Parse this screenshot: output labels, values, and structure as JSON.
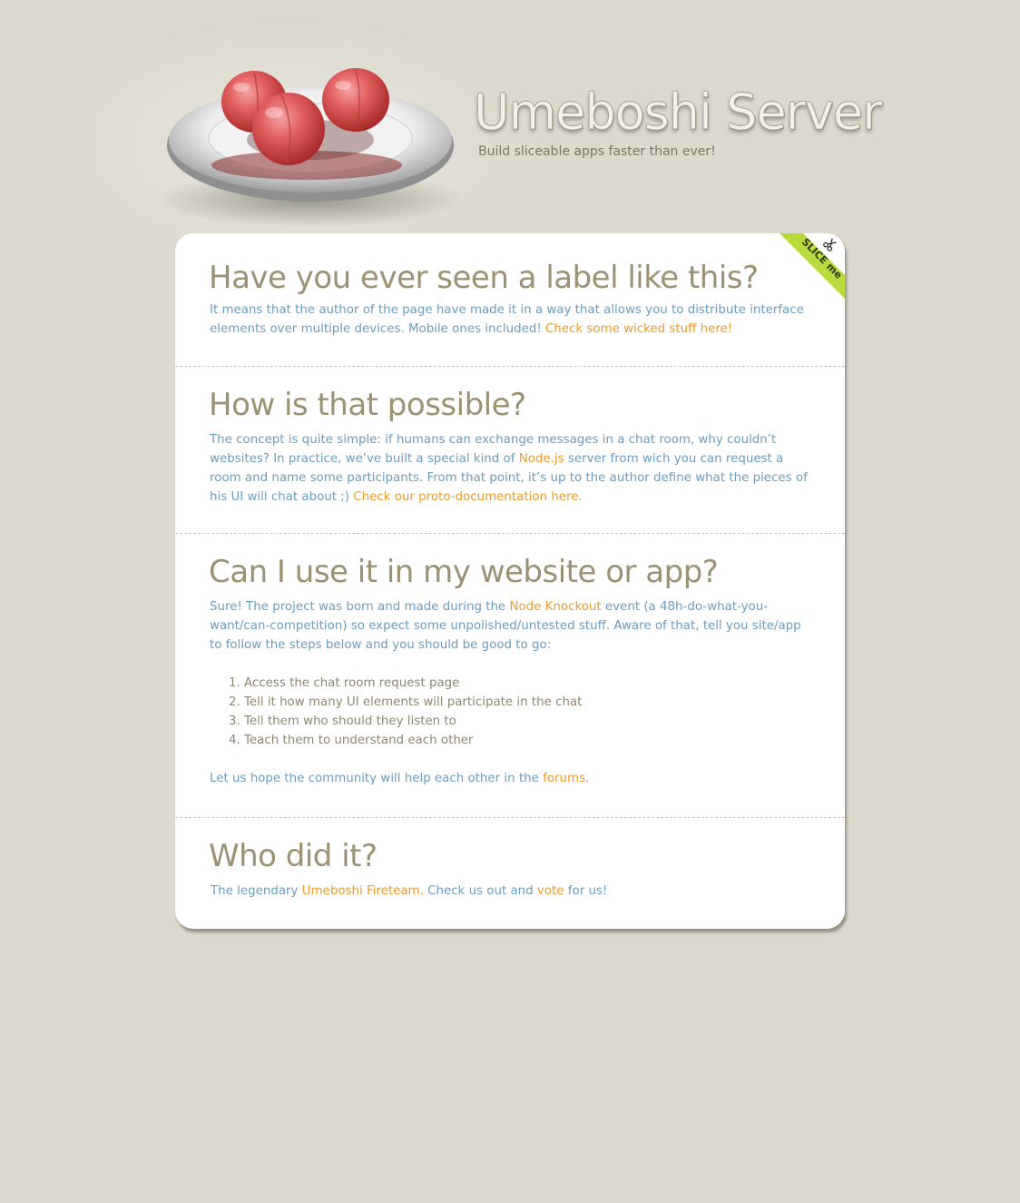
{
  "header": {
    "title": "Umeboshi Server",
    "tagline": "Build sliceable apps faster than ever!"
  },
  "badge": {
    "label": "SLICE me",
    "icon": "scissors-icon",
    "color": "#b9db3c"
  },
  "colors": {
    "background": "#dcdace",
    "heading": "#9b9173",
    "body_text": "#6a9cbe",
    "link": "#ec9a2a",
    "list_text": "#8d8570"
  },
  "sections": [
    {
      "heading": "Have you ever seen a label like this?",
      "text": "It means that the author of the page have made it in a way that allows you to distribute interface elements over multiple devices. Mobile ones included! ",
      "link": "Check some wicked stuff here!"
    },
    {
      "heading": "How is that possible?",
      "text_1": "The concept is quite simple: if humans can exchange messages in a chat room, why couldn’t websites? In practice, we’ve built a special kind of ",
      "link_1": "Node.js",
      "text_2": " server from wich you can request a room and name some participants. From that point, it’s up to the author define what the pieces of his UI will chat about ;)  ",
      "link_2": "Check our proto-documentation here."
    },
    {
      "heading": "Can I use it in my website or app?",
      "text_1": "Sure! The project was born and made during the ",
      "link_1": "Node Knockout",
      "text_2": " event (a 48h-do-what-you-want/can-competition) so expect some unpolished/untested stuff. Aware of that, tell you site/app to follow the steps below and you should be good to go:",
      "steps": [
        "Access the chat room request page",
        "Tell it how many UI elements will participate in the chat",
        "Tell them who should they listen to",
        "Teach them to understand each other"
      ],
      "footer_text": "Let us hope the community will help each other in the ",
      "footer_link": "forums."
    },
    {
      "heading": "Who did it?",
      "text_1": "The legendary ",
      "link_1": "Umeboshi Fireteam.",
      "text_2": " Check us out and ",
      "link_2": "vote",
      "text_3": " for us!"
    }
  ]
}
